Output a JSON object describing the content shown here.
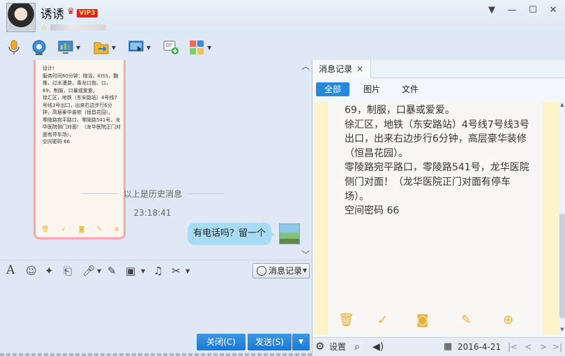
{
  "header": {
    "contact_name": "诱诱",
    "vip_label": "VIP3",
    "window_buttons": {
      "dropdown": "▼",
      "minimize": "—",
      "maximize": "☐",
      "close": "✕"
    }
  },
  "toolbar": {
    "icons": [
      "microphone-icon",
      "video-camera-icon",
      "screen-share-icon",
      "file-transfer-icon",
      "remote-desktop-icon",
      "add-chat-icon",
      "apps-grid-icon"
    ]
  },
  "chat": {
    "card_text": "设计!\n服务时间60分钟：陪浴，KISS，胸推，过水漫游，毒龙口炮，口，69，制服，口暴或爱爱。\n徐汇区，地铁（东安路站）4号线7号线3号出口，出来右边步行6分钟，高层豪华装修（恒昌花园）。\n零陵路宛平路口，零陵路541号，龙华医院侧门对面！（龙华医院正门对面有停车场）。\n空间密码 66",
    "history_label": "以上是历史消息",
    "timestamp": "23:18:41",
    "message": "有电话吗？留一个"
  },
  "input_toolbar": {
    "message_record_label": "消息记录"
  },
  "actions": {
    "close_label": "关闭(C)",
    "send_label": "发送(S)"
  },
  "history_panel": {
    "tab_label": "消息记录",
    "filters": [
      "全部",
      "图片",
      "文件"
    ],
    "note_text": "69，制服，口暴或爱爱。\n徐汇区，地铁（东安路站）4号线7号线3号出口，出来右边步行6分钟，高层豪华装修（恒昌花园）。\n零陵路宛平路口，零陵路541号，龙华医院侧门对面！（龙华医院正门对面有停车场）。\n空间密码 66",
    "footer": {
      "settings_label": "设置",
      "date": "2016-4-21"
    }
  },
  "colors": {
    "accent": "#2b87da",
    "bubble": "#a8dcf6",
    "note_border": "#fdf4cc",
    "card_border": "#f3a9ad"
  }
}
